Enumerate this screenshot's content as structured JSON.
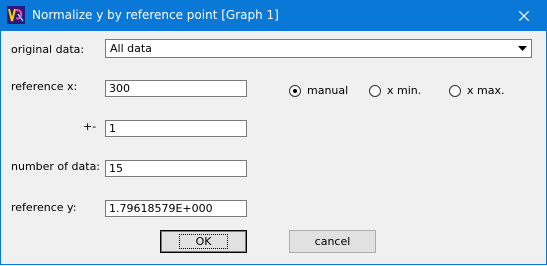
{
  "window": {
    "title": "Normalize y by reference point [Graph 1]"
  },
  "labels": {
    "original_data": "original data:",
    "reference_x": "reference x:",
    "tolerance": "+-",
    "number_of_data": "number of data:",
    "reference_y": "reference y:"
  },
  "original_data": {
    "selected": "All data"
  },
  "fields": {
    "reference_x": "300",
    "tolerance": "1",
    "number_of_data": "15",
    "reference_y": "1.79618579E+000"
  },
  "radios": [
    {
      "label": "manual",
      "checked": true
    },
    {
      "label": "x min.",
      "checked": false
    },
    {
      "label": "x max.",
      "checked": false
    }
  ],
  "buttons": {
    "ok": "OK",
    "cancel": "cancel"
  },
  "colors": {
    "titlebar": "#0a78d7",
    "dialog_bg": "#f0f0f0"
  }
}
